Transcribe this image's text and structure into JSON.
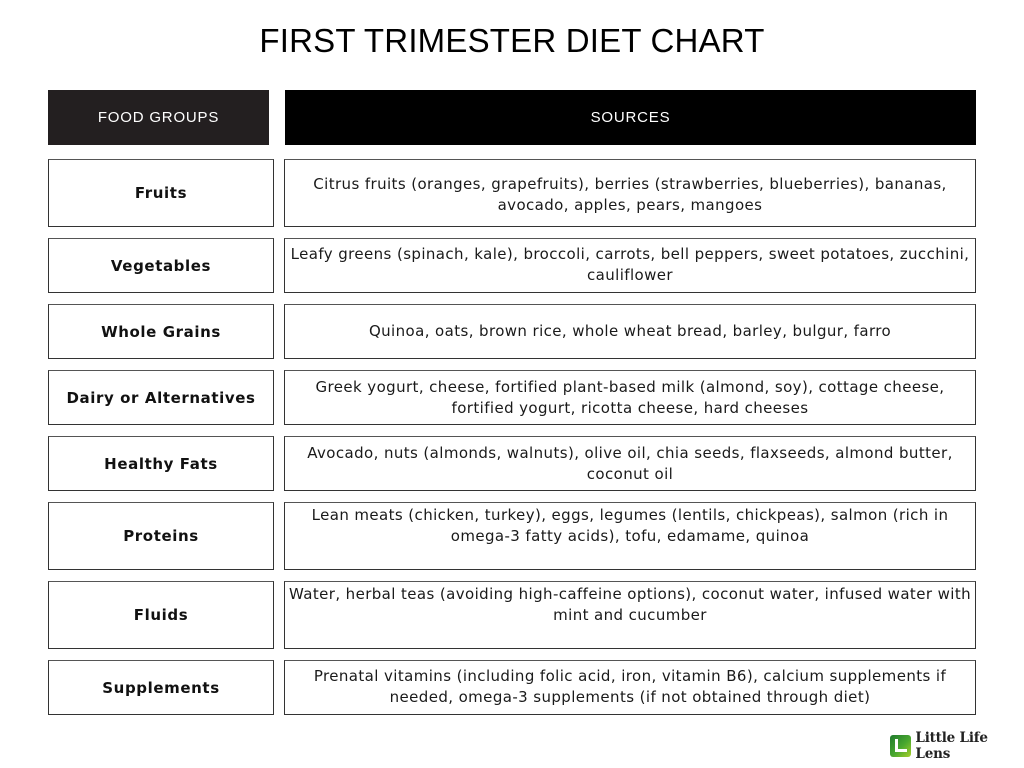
{
  "title": "FIRST TRIMESTER DIET CHART",
  "headers": {
    "food_groups": "FOOD GROUPS",
    "sources": "SOURCES"
  },
  "colors": {
    "header_left_bg": "#231f20",
    "header_right_bg": "#000000",
    "logo_green": "#4aa82f"
  },
  "rows": [
    {
      "group": "Fruits",
      "sources": "Citrus fruits (oranges, grapefruits), berries (strawberries, blueberries), bananas, avocado, apples, pears, mangoes"
    },
    {
      "group": "Vegetables",
      "sources": "Leafy greens (spinach, kale), broccoli, carrots, bell peppers, sweet potatoes, zucchini, cauliflower"
    },
    {
      "group": "Whole Grains",
      "sources": "Quinoa, oats, brown rice, whole wheat bread, barley, bulgur, farro"
    },
    {
      "group": "Dairy or Alternatives",
      "sources": "Greek yogurt, cheese, fortified plant-based milk (almond, soy), cottage cheese, fortified yogurt, ricotta cheese, hard cheeses"
    },
    {
      "group": "Healthy Fats",
      "sources": "Avocado, nuts (almonds, walnuts), olive oil, chia seeds, flaxseeds, almond butter, coconut oil"
    },
    {
      "group": "Proteins",
      "sources": "Lean meats (chicken, turkey), eggs, legumes (lentils, chickpeas), salmon (rich in omega-3 fatty acids), tofu, edamame, quinoa"
    },
    {
      "group": "Fluids",
      "sources": "Water, herbal teas (avoiding high-caffeine options), coconut water, infused water with mint and cucumber"
    },
    {
      "group": "Supplements",
      "sources": "Prenatal vitamins (including folic acid, iron, vitamin B6), calcium supplements if needed, omega-3 supplements (if not obtained through diet)"
    }
  ],
  "brand": {
    "name": "Little Life Lens",
    "icon": "little-life-lens-logo-icon"
  }
}
